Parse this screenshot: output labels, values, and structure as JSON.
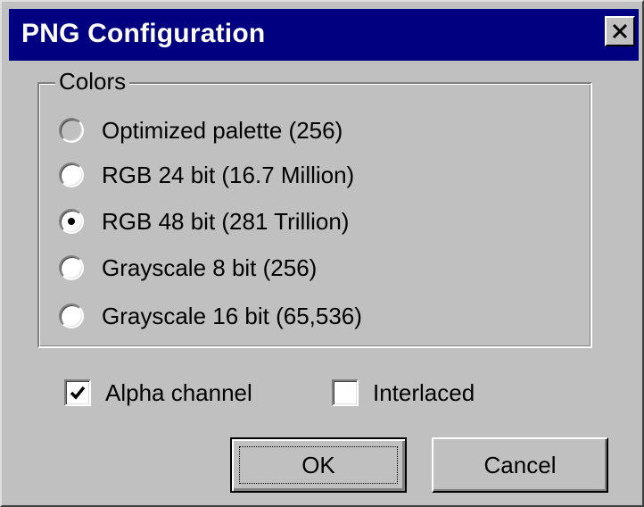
{
  "window": {
    "title": "PNG Configuration",
    "close_icon": "close-icon"
  },
  "colors_group": {
    "label": "Colors",
    "options": [
      {
        "label": "Optimized palette  (256)",
        "selected": false,
        "enabled": false
      },
      {
        "label": "RGB 24 bit  (16.7 Million)",
        "selected": false,
        "enabled": true
      },
      {
        "label": "RGB 48 bit  (281 Trillion)",
        "selected": true,
        "enabled": true
      },
      {
        "label": "Grayscale 8 bit  (256)",
        "selected": false,
        "enabled": true
      },
      {
        "label": "Grayscale 16 bit  (65,536)",
        "selected": false,
        "enabled": true
      }
    ]
  },
  "options": {
    "alpha_channel": {
      "label": "Alpha channel",
      "checked": true
    },
    "interlaced": {
      "label": "Interlaced",
      "checked": false
    }
  },
  "buttons": {
    "ok": "OK",
    "cancel": "Cancel"
  },
  "theme": {
    "titlebar_bg": "#000080",
    "titlebar_fg": "#ffffff",
    "face": "#c0c0c0"
  }
}
